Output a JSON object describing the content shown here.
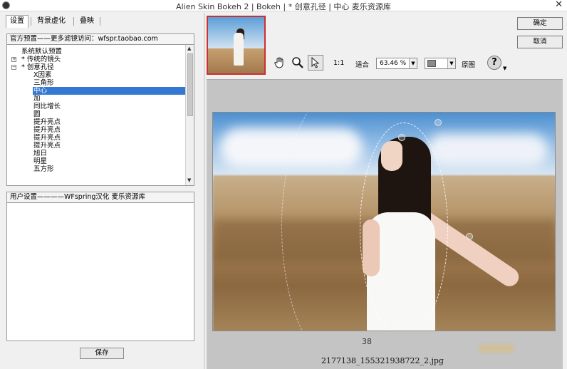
{
  "window": {
    "title": "Alien Skin Bokeh 2 | Bokeh | * 创意孔径 | 中心 麦乐资源库",
    "close_glyph": "✕"
  },
  "tabs": [
    {
      "label": "设置"
    },
    {
      "label": "背景虚化"
    },
    {
      "label": "叠映"
    }
  ],
  "presets": {
    "header": "官方预置——更多滤镜访问：wfspr.taobao.com",
    "items": [
      {
        "label": "系统默认预置",
        "expander": ""
      },
      {
        "label": "* 传统的镜头",
        "expander": "+"
      },
      {
        "label": "* 创意孔径",
        "expander": "−"
      },
      {
        "label": "X因素",
        "expander": ""
      },
      {
        "label": "三角形",
        "expander": ""
      },
      {
        "label": "中心",
        "expander": ""
      },
      {
        "label": "加",
        "expander": ""
      },
      {
        "label": "同比增长",
        "expander": ""
      },
      {
        "label": "圆",
        "expander": ""
      },
      {
        "label": "提升亮点",
        "expander": ""
      },
      {
        "label": "提升亮点",
        "expander": ""
      },
      {
        "label": "提升亮点",
        "expander": ""
      },
      {
        "label": "提升亮点",
        "expander": ""
      },
      {
        "label": "旭日",
        "expander": ""
      },
      {
        "label": "明星",
        "expander": ""
      },
      {
        "label": "五方形",
        "expander": ""
      }
    ],
    "selected_label": "中心"
  },
  "user_settings": {
    "header": "用户设置————WFspring汉化 麦乐资源库"
  },
  "buttons": {
    "save": "保存",
    "ok": "确定",
    "cancel": "取消"
  },
  "toolbar": {
    "hand_icon": "hand-icon",
    "zoom_icon": "magnifier-icon",
    "select_icon": "arrow-pointer-icon",
    "actual_size": "1:1",
    "fit": "适合",
    "zoom_value": "63.46 %",
    "bg_color": "#8a8a8a",
    "original_label": "原图",
    "help_glyph": "?"
  },
  "preview": {
    "center_number": "38",
    "filename": "2177138_155321938722_2.jpg"
  },
  "colors": {
    "selection": "#3478d4",
    "thumb_border": "#cc3030"
  }
}
